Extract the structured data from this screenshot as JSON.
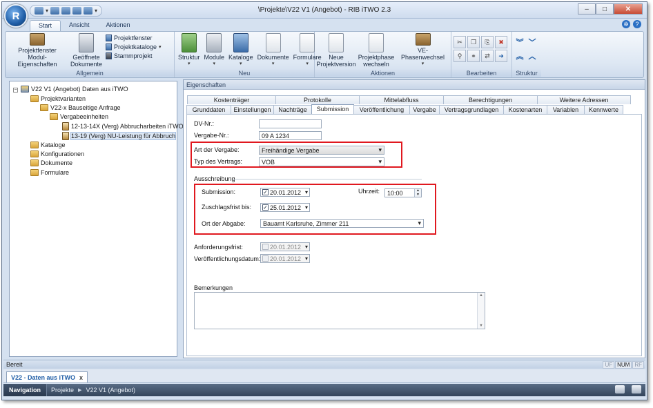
{
  "window": {
    "title": "\\Projekte\\V22 V1 (Angebot) - RIB iTWO 2.3",
    "app_glyph": "R",
    "controls": {
      "minimize": "–",
      "maximize": "□",
      "close": "✕"
    }
  },
  "ribbon": {
    "tabs": [
      "Start",
      "Ansicht",
      "Aktionen"
    ],
    "active_tab": "Start",
    "groups": {
      "allgemein": {
        "label": "Allgemein",
        "projektfenster_big": "Projektfenster Modul-Eigenschaften",
        "geoeffnete": "Geöffnete Dokumente",
        "small": [
          "Projektfenster",
          "Projektkataloge",
          "Stammprojekt"
        ]
      },
      "neu": {
        "label": "Neu",
        "items": [
          "Struktur",
          "Module",
          "Kataloge",
          "Dokumente",
          "Formulare"
        ]
      },
      "aktionen": {
        "label": "Aktionen",
        "items": [
          "Neue Projektversion",
          "Projektphase wechseln",
          "VE-Phasenwechsel"
        ]
      },
      "bearbeiten": {
        "label": "Bearbeiten"
      },
      "struktur": {
        "label": "Struktur"
      }
    }
  },
  "tree": {
    "root": "V22 V1 (Angebot) Daten aus iTWO",
    "projektvarianten": "Projektvarianten",
    "variant": "V22-x Bauseitige Anfrage",
    "vergabeeinheiten": "Vergabeeinheiten",
    "ve1": "12-13-14X (Verg) Abbrucharbeiten iTWO",
    "ve2": "13-19 (Verg) NU-Leistung für Abbruch",
    "kataloge": "Kataloge",
    "konfigurationen": "Konfigurationen",
    "dokumente": "Dokumente",
    "formulare": "Formulare"
  },
  "properties": {
    "header": "Eigenschaften",
    "tabs_row1": [
      "Kostenträger",
      "Protokolle",
      "Mittelabfluss",
      "Berechtigungen",
      "Weitere Adressen"
    ],
    "tabs_row2": [
      "Grunddaten",
      "Einstellungen",
      "Nachträge",
      "Submission",
      "Veröffentlichung",
      "Vergabe",
      "Vertragsgrundlagen",
      "Kostenarten",
      "Variablen",
      "Kennwerte"
    ],
    "active_tab": "Submission",
    "form": {
      "dv_nr_label": "DV-Nr.:",
      "dv_nr_value": "",
      "vergabe_nr_label": "Vergabe-Nr.:",
      "vergabe_nr_value": "09 A 1234",
      "art_label": "Art der Vergabe:",
      "art_value": "Freihändige Vergabe",
      "typ_label": "Typ des Vertrags:",
      "typ_value": "VOB",
      "ausschreibung_label": "Ausschreibung",
      "submission_label": "Submission:",
      "submission_date": "20.01.2012",
      "submission_checked": true,
      "uhrzeit_label": "Uhrzeit:",
      "uhrzeit_value": "10:00",
      "zuschlag_label": "Zuschlagsfrist bis:",
      "zuschlag_date": "25.01.2012",
      "zuschlag_checked": true,
      "ort_label": "Ort der Abgabe:",
      "ort_value": "Bauamt Karlsruhe, Zimmer 211",
      "anforderung_label": "Anforderungsfrist:",
      "anforderung_date": "20.01.2012",
      "veroeffentlichung_label": "Veröffentlichungsdatum:",
      "veroeffentlichung_date": "20.01.2012",
      "bemerkungen_label": "Bemerkungen",
      "bemerkungen_value": ""
    }
  },
  "status": {
    "text": "Bereit",
    "indicators": [
      "UF",
      "NUM",
      "RF"
    ]
  },
  "doc_tab": {
    "label": "V22 - Daten aus iTWO",
    "close": "x"
  },
  "navigation": {
    "title": "Navigation",
    "breadcrumbs": [
      "Projekte",
      "V22 V1 (Angebot)"
    ]
  },
  "colors": {
    "highlight_box": "#e0181f",
    "accent": "#1f5da6"
  }
}
